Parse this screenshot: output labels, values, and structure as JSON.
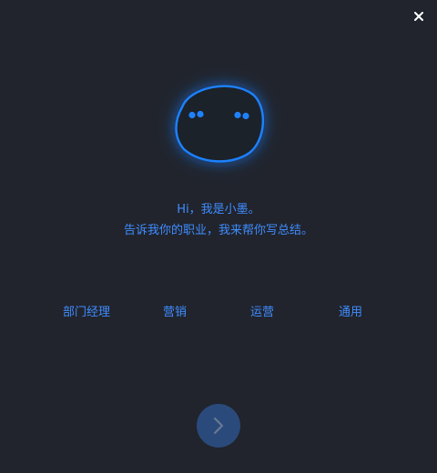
{
  "greeting": "Hi，我是小墨。",
  "prompt": "告诉我你的职业，我来帮你写总结。",
  "options": [
    {
      "label": "部门经理"
    },
    {
      "label": "营销"
    },
    {
      "label": "运营"
    },
    {
      "label": "通用"
    }
  ],
  "icons": {
    "close": "close-icon",
    "next": "chevron-right-icon",
    "mascot": "mascot-face"
  },
  "colors": {
    "background": "#21242c",
    "accent": "#3f8cff",
    "mascot_glow": "#1e7bff",
    "next_button": "#2b4a7c"
  }
}
